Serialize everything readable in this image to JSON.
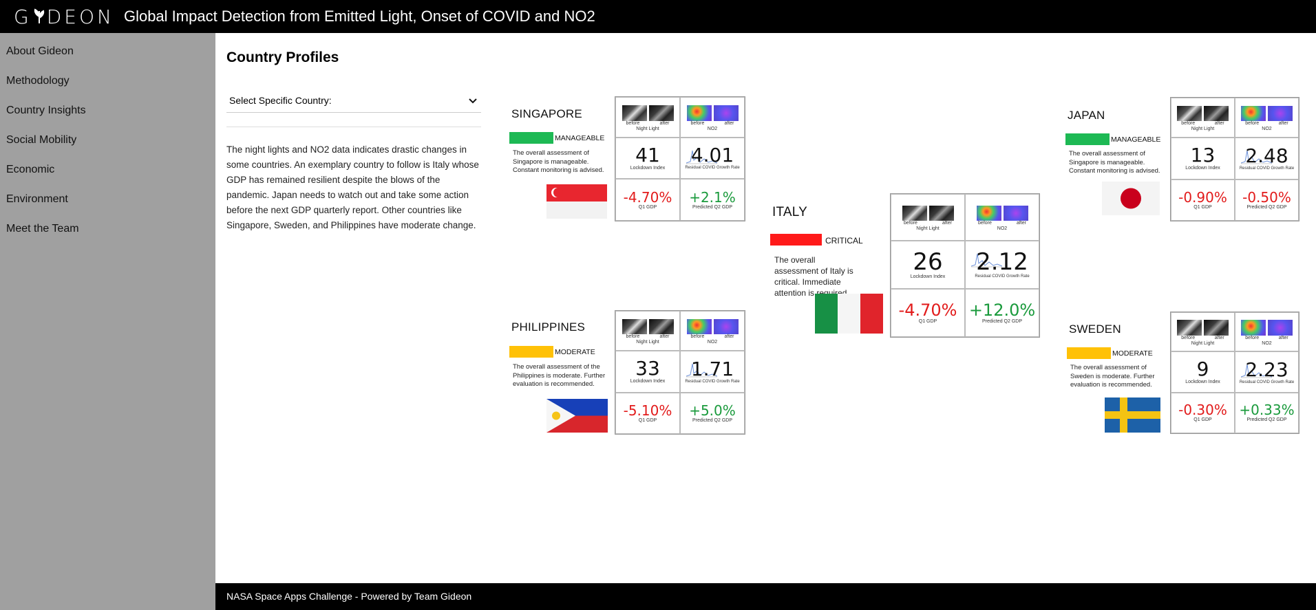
{
  "header": {
    "logo": "GIDEON",
    "title": "Global Impact Detection from Emitted Light, Onset of COVID and NO2"
  },
  "sidebar": {
    "items": [
      {
        "label": "About Gideon"
      },
      {
        "label": "Methodology"
      },
      {
        "label": "Country Insights"
      },
      {
        "label": "Social Mobility"
      },
      {
        "label": "Economic"
      },
      {
        "label": "Environment"
      },
      {
        "label": "Meet the Team"
      }
    ]
  },
  "main": {
    "title": "Country Profiles",
    "select": {
      "value": "Select Specific Country:"
    },
    "intro": "The night lights and NO2 data indicates drastic changes in some countries. An exemplary country to follow is Italy whose GDP has remained resilient despite the blows of the pandemic. Japan needs to watch out and take some action before the next GDP quarterly report. Other countries like Singapore, Sweden, and Philippines have moderate change."
  },
  "labels": {
    "before": "before",
    "after": "after",
    "night_light": "Night Light",
    "no2": "NO2",
    "lockdown": "Lockdown Index",
    "residual": "Residual COVID Growth Rate",
    "q1": "Q1 GDP",
    "q2": "Predicted Q2 GDP"
  },
  "countries": {
    "singapore": {
      "name": "SINGAPORE",
      "status": "MANAGEABLE",
      "status_color": "#1db954",
      "desc": "The overall assessment of Singapore is manageable. Constant monitoring is advised.",
      "lockdown": "41",
      "residual": "4.01",
      "q1": "-4.70%",
      "q2": "+2.1%"
    },
    "japan": {
      "name": "JAPAN",
      "status": "MANAGEABLE",
      "status_color": "#1db954",
      "desc": "The overall assessment of Singapore is manageable. Constant monitoring is advised.",
      "lockdown": "13",
      "residual": "2.48",
      "q1": "-0.90%",
      "q2": "-0.50%"
    },
    "italy": {
      "name": "ITALY",
      "status": "CRITICAL",
      "status_color": "#ff1a1a",
      "desc": "The overall assessment of Italy is critical. Immediate attention is required.",
      "lockdown": "26",
      "residual": "2.12",
      "q1": "-4.70%",
      "q2": "+12.0%"
    },
    "philippines": {
      "name": "PHILIPPINES",
      "status": "MODERATE",
      "status_color": "#ffc107",
      "desc": "The overall assessment of the Philippines is moderate. Further evaluation is recommended.",
      "lockdown": "33",
      "residual": "1.71",
      "q1": "-5.10%",
      "q2": "+5.0%"
    },
    "sweden": {
      "name": "SWEDEN",
      "status": "MODERATE",
      "status_color": "#ffc107",
      "desc": "The overall assessment of Sweden is moderate. Further evaluation is recommended.",
      "lockdown": "9",
      "residual": "2.23",
      "q1": "-0.30%",
      "q2": "+0.33%"
    }
  },
  "footer": {
    "text": "NASA Space Apps Challenge - Powered by Team Gideon"
  }
}
